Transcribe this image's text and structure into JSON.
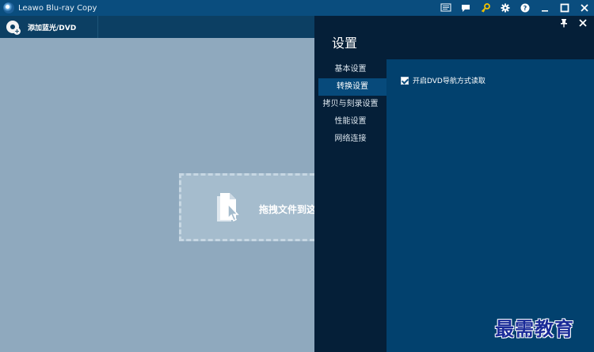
{
  "app": {
    "title": "Leawo Blu-ray Copy"
  },
  "title_controls": [
    "screen-icon",
    "message-icon",
    "key-icon",
    "gear-icon",
    "help-icon",
    "minimize-icon",
    "maximize-icon",
    "close-icon"
  ],
  "toolbar": {
    "add_disc_label": "添加蓝光/DVD"
  },
  "workspace": {
    "drop_label": "拖拽文件到这"
  },
  "settings": {
    "title": "设置",
    "nav": [
      {
        "label": "基本设置",
        "active": false
      },
      {
        "label": "转换设置",
        "active": true
      },
      {
        "label": "拷贝与刻录设置",
        "active": false
      },
      {
        "label": "性能设置",
        "active": false
      },
      {
        "label": "网络连接",
        "active": false
      }
    ],
    "option": {
      "label": "开启DVD导航方式读取",
      "checked": true
    }
  },
  "watermark": "最需教育",
  "colors": {
    "titlebar": "#0a4d7e",
    "toolbar": "#0c3f63",
    "settings_bg": "#051f38",
    "settings_content": "#02416e",
    "workspace": "#8fa9be",
    "key_icon": "#f2c200"
  }
}
